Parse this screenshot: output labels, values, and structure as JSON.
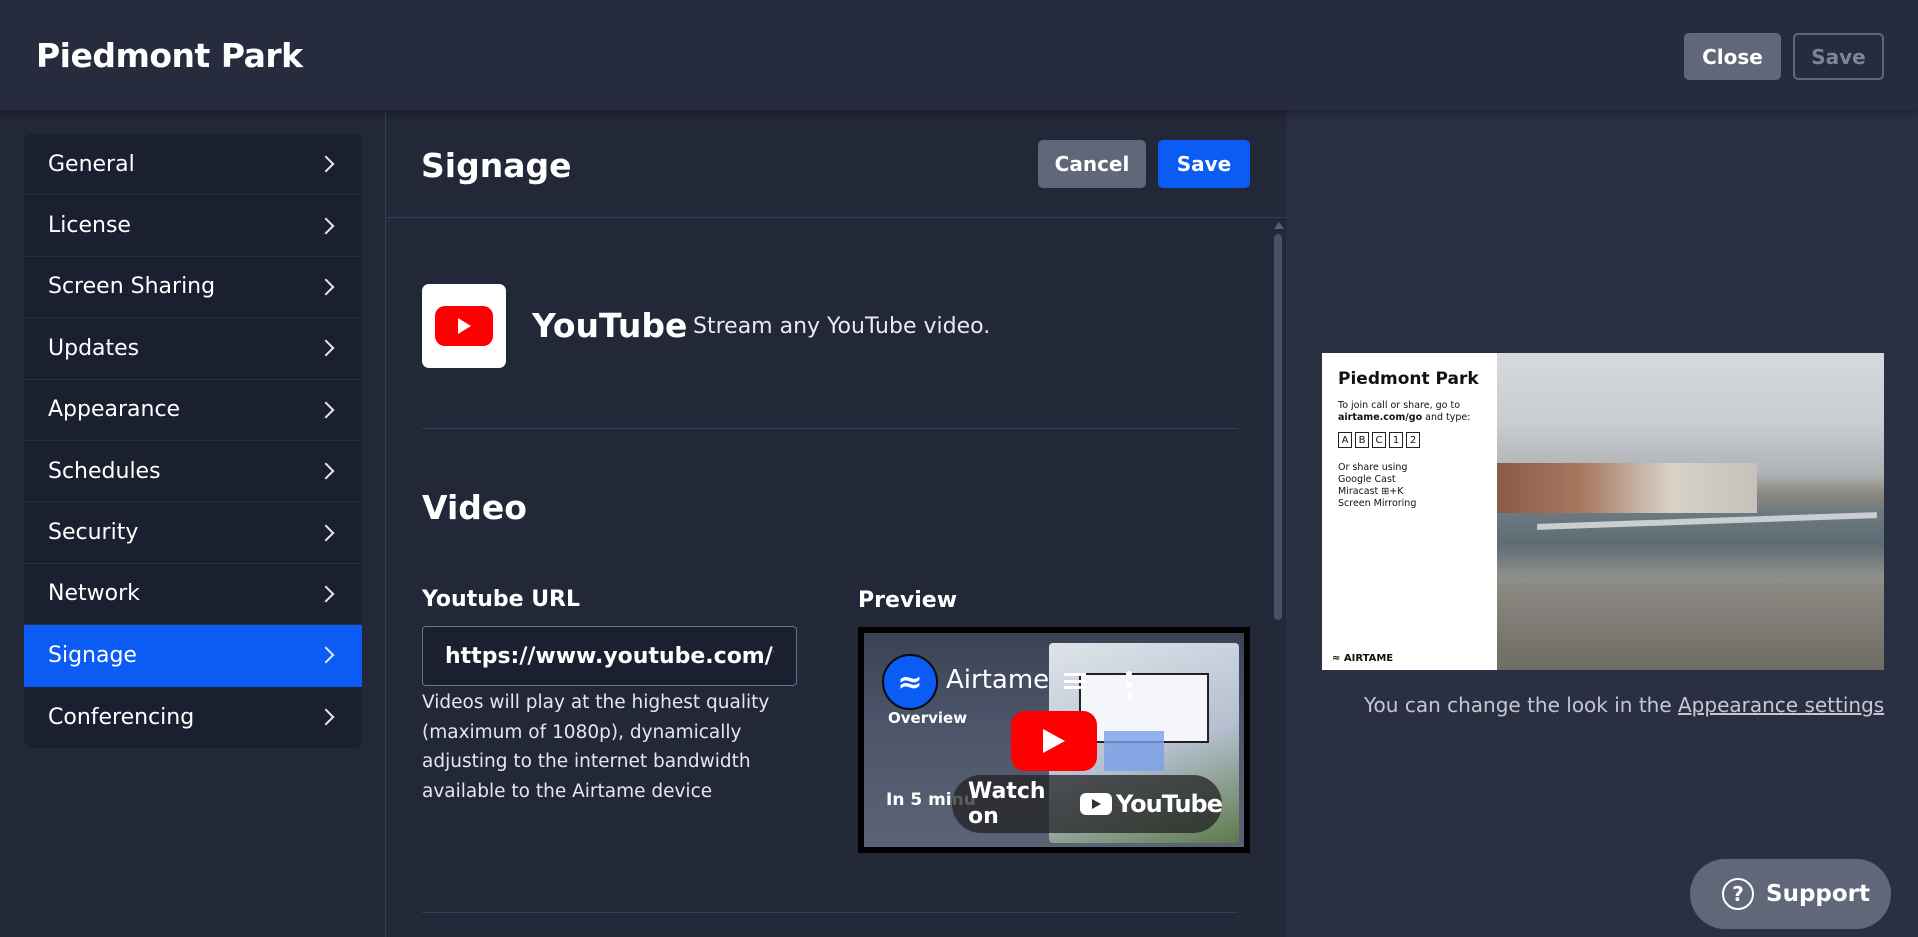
{
  "header": {
    "title": "Piedmont Park",
    "close_label": "Close",
    "save_label": "Save"
  },
  "sidebar": {
    "items": [
      {
        "label": "General"
      },
      {
        "label": "License"
      },
      {
        "label": "Screen Sharing"
      },
      {
        "label": "Updates"
      },
      {
        "label": "Appearance"
      },
      {
        "label": "Schedules"
      },
      {
        "label": "Security"
      },
      {
        "label": "Network"
      },
      {
        "label": "Signage",
        "active": true
      },
      {
        "label": "Conferencing"
      }
    ]
  },
  "main": {
    "heading": "Signage",
    "cancel_label": "Cancel",
    "save_label": "Save",
    "app": {
      "name": "YouTube",
      "description": "Stream any YouTube video."
    },
    "video_heading": "Video",
    "url_label": "Youtube URL",
    "url_value": "https://www.youtube.com/w...",
    "hint": "Videos will play at the highest quality (maximum of 1080p), dynamically adjusting to the internet bandwidth available to the Airtame device",
    "preview_label": "Preview",
    "preview": {
      "channel": "Airtame",
      "channel_initial": "≈",
      "subtitle": "Overview",
      "duration": "In 5 minu",
      "watch_label": "Watch on",
      "yt_brand": "YouTube"
    }
  },
  "signage_card": {
    "title": "Piedmont Park",
    "join_text": "To join call or share, go to",
    "join_url": "airtame.com/go",
    "join_suffix": "and type:",
    "codes": [
      "A",
      "B",
      "C",
      "1",
      "2"
    ],
    "share_heading": "Or share using",
    "share_methods": [
      "Google Cast",
      "Miracast ⊞+K",
      "Screen Mirroring"
    ],
    "brand": "≈ AIRTAME"
  },
  "appearance_note": {
    "text": "You can change the look in the",
    "link": "Appearance settings"
  },
  "support": {
    "label": "Support",
    "icon": "?"
  },
  "colors": {
    "accent": "#0a5cf5",
    "background": "#222838",
    "youtube_red": "#ff0000"
  }
}
